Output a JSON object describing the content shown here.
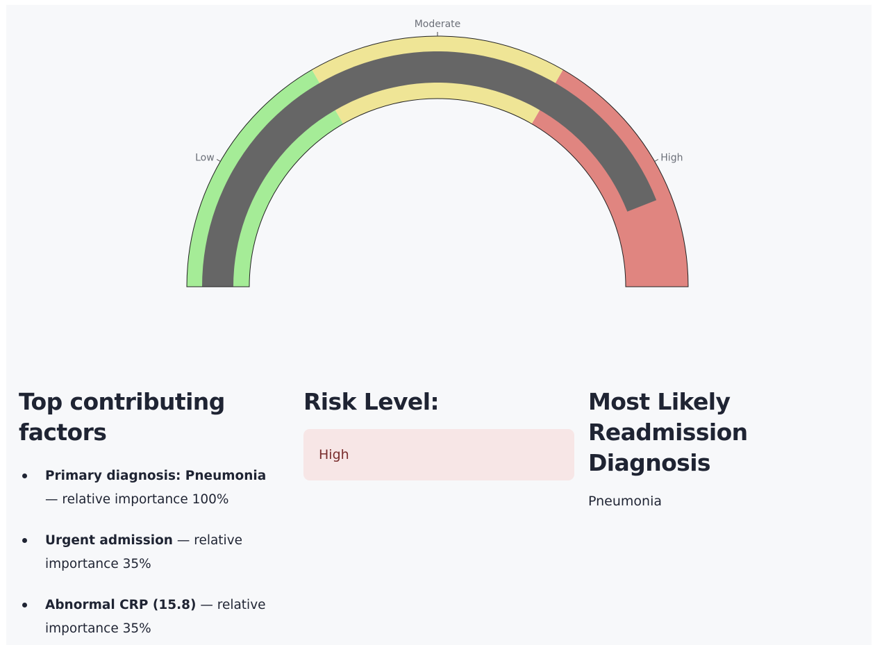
{
  "gauge": {
    "value": 88,
    "min": 0,
    "max": 100,
    "bands": [
      {
        "from": 0,
        "to": 33.3,
        "color": "#a5ec97"
      },
      {
        "from": 33.3,
        "to": 66.7,
        "color": "#efe596"
      },
      {
        "from": 66.7,
        "to": 100,
        "color": "#e08580"
      }
    ],
    "bar_color": "#666666",
    "tick_labels": [
      "Low",
      "Moderate",
      "High"
    ]
  },
  "factors": {
    "heading": "Top contributing factors",
    "items": [
      {
        "bold": "Primary diagnosis: Pneumonia",
        "text": " — relative importance 100%"
      },
      {
        "bold": "Urgent admission",
        "text": " — relative importance 35%"
      },
      {
        "bold": "Abnormal CRP (15.8)",
        "text": " — relative importance 35%"
      }
    ]
  },
  "risk": {
    "heading": "Risk Level:",
    "value": "High"
  },
  "diagnosis": {
    "heading": "Most Likely Readmission Diagnosis",
    "value": "Pneumonia"
  }
}
